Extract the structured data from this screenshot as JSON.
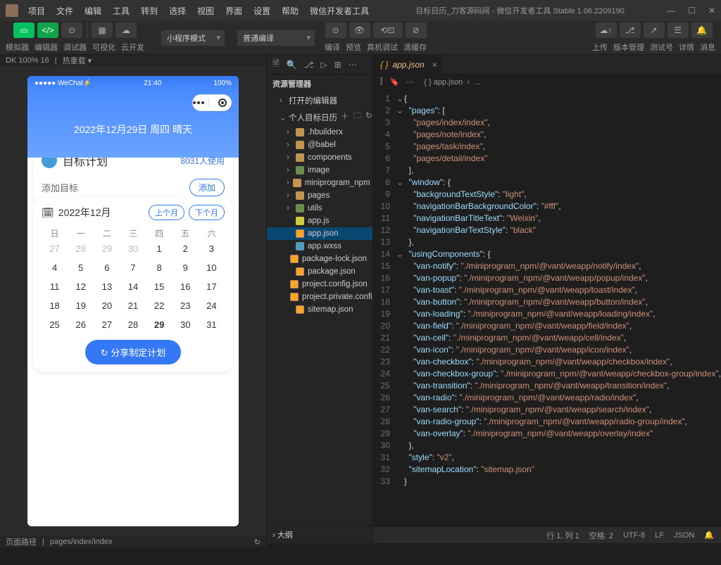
{
  "menus": [
    "项目",
    "文件",
    "编辑",
    "工具",
    "转到",
    "选择",
    "视图",
    "界面",
    "设置",
    "帮助",
    "微信开发者工具"
  ],
  "title": "目标日历_刀客源码网 - 微信开发者工具 Stable 1.06.2209190",
  "toolbar": {
    "left_labels": [
      "模拟器",
      "编辑器",
      "调试器",
      "可视化",
      "云开发"
    ],
    "mode": "小程序模式",
    "compile": "普通编译",
    "mid_labels": [
      "编译",
      "预览",
      "真机调试",
      "清缓存"
    ],
    "right_labels": [
      "上传",
      "版本管理",
      "测试号",
      "详情",
      "消息"
    ]
  },
  "zoom": {
    "dk": "DK 100% 16",
    "hot": "热重载 ▾"
  },
  "phone": {
    "carrier": "●●●●● WeChat⚡",
    "time": "21:40",
    "battery": "100%",
    "heroDate": "2022年12月29日 周四 晴天",
    "planTitle": "目标计划",
    "usersText": "8031人使用",
    "addLabel": "添加目标",
    "addBtn": "添加",
    "monthLabel": "2022年12月",
    "prevMonth": "上个月",
    "nextMonth": "下个月",
    "weekdays": [
      "日",
      "一",
      "二",
      "三",
      "四",
      "五",
      "六"
    ],
    "days": [
      {
        "n": "27"
      },
      {
        "n": "28"
      },
      {
        "n": "29"
      },
      {
        "n": "30"
      },
      {
        "n": "1",
        "c": 1
      },
      {
        "n": "2",
        "c": 1
      },
      {
        "n": "3",
        "c": 1
      },
      {
        "n": "4",
        "c": 1
      },
      {
        "n": "5",
        "c": 1
      },
      {
        "n": "6",
        "c": 1
      },
      {
        "n": "7",
        "c": 1
      },
      {
        "n": "8",
        "c": 1
      },
      {
        "n": "9",
        "c": 1
      },
      {
        "n": "10",
        "c": 1
      },
      {
        "n": "11",
        "c": 1
      },
      {
        "n": "12",
        "c": 1
      },
      {
        "n": "13",
        "c": 1
      },
      {
        "n": "14",
        "c": 1
      },
      {
        "n": "15",
        "c": 1
      },
      {
        "n": "16",
        "c": 1
      },
      {
        "n": "17",
        "c": 1
      },
      {
        "n": "18",
        "c": 1
      },
      {
        "n": "19",
        "c": 1
      },
      {
        "n": "20",
        "c": 1
      },
      {
        "n": "21",
        "c": 1
      },
      {
        "n": "22",
        "c": 1
      },
      {
        "n": "23",
        "c": 1
      },
      {
        "n": "24",
        "c": 1
      },
      {
        "n": "25",
        "c": 1
      },
      {
        "n": "26",
        "c": 1
      },
      {
        "n": "27",
        "c": 1
      },
      {
        "n": "28",
        "c": 1
      },
      {
        "n": "29",
        "t": 1
      },
      {
        "n": "30",
        "c": 1
      },
      {
        "n": "31",
        "c": 1
      }
    ],
    "shareBtn": "↻ 分享制定计划"
  },
  "explorer": {
    "title": "资源管理器",
    "openEditors": "打开的编辑器",
    "project": "个人目标日历",
    "outline": "大纲",
    "items": [
      {
        "label": ".hbuilderx",
        "caret": "›",
        "icon": "folder"
      },
      {
        "label": "@babel",
        "caret": "›",
        "icon": "folder"
      },
      {
        "label": "components",
        "caret": "›",
        "icon": "folder"
      },
      {
        "label": "image",
        "caret": "›",
        "icon": "cfg"
      },
      {
        "label": "miniprogram_npm",
        "caret": "›",
        "icon": "folder"
      },
      {
        "label": "pages",
        "caret": "›",
        "icon": "folder"
      },
      {
        "label": "utils",
        "caret": "›",
        "icon": "cfg"
      },
      {
        "label": "app.js",
        "icon": "js"
      },
      {
        "label": "app.json",
        "icon": "json",
        "sel": true
      },
      {
        "label": "app.wxss",
        "icon": "css"
      },
      {
        "label": "package-lock.json",
        "icon": "json"
      },
      {
        "label": "package.json",
        "icon": "json"
      },
      {
        "label": "project.config.json",
        "icon": "json"
      },
      {
        "label": "project.private.config.js...",
        "icon": "json"
      },
      {
        "label": "sitemap.json",
        "icon": "json"
      }
    ]
  },
  "tabs": {
    "active": "app.json"
  },
  "breadcrumb": [
    "{ } app.json",
    "›",
    "..."
  ],
  "code": {
    "lines": [
      [
        [
          "p",
          "{"
        ]
      ],
      [
        [
          "p",
          "  "
        ],
        [
          "k",
          "\"pages\""
        ],
        [
          "p",
          ": ["
        ]
      ],
      [
        [
          "p",
          "    "
        ],
        [
          "s",
          "\"pages/index/index\""
        ],
        [
          "p",
          ","
        ]
      ],
      [
        [
          "p",
          "    "
        ],
        [
          "s",
          "\"pages/note/index\""
        ],
        [
          "p",
          ","
        ]
      ],
      [
        [
          "p",
          "    "
        ],
        [
          "s",
          "\"pages/task/index\""
        ],
        [
          "p",
          ","
        ]
      ],
      [
        [
          "p",
          "    "
        ],
        [
          "s",
          "\"pages/detail/index\""
        ]
      ],
      [
        [
          "p",
          "  ],"
        ]
      ],
      [
        [
          "p",
          "  "
        ],
        [
          "k",
          "\"window\""
        ],
        [
          "p",
          ": {"
        ]
      ],
      [
        [
          "p",
          "    "
        ],
        [
          "k",
          "\"backgroundTextStyle\""
        ],
        [
          "p",
          ": "
        ],
        [
          "s",
          "\"light\""
        ],
        [
          "p",
          ","
        ]
      ],
      [
        [
          "p",
          "    "
        ],
        [
          "k",
          "\"navigationBarBackgroundColor\""
        ],
        [
          "p",
          ": "
        ],
        [
          "s",
          "\"#fff\""
        ],
        [
          "p",
          ","
        ]
      ],
      [
        [
          "p",
          "    "
        ],
        [
          "k",
          "\"navigationBarTitleText\""
        ],
        [
          "p",
          ": "
        ],
        [
          "s",
          "\"Weixin\""
        ],
        [
          "p",
          ","
        ]
      ],
      [
        [
          "p",
          "    "
        ],
        [
          "k",
          "\"navigationBarTextStyle\""
        ],
        [
          "p",
          ": "
        ],
        [
          "s",
          "\"black\""
        ]
      ],
      [
        [
          "p",
          "  },"
        ]
      ],
      [
        [
          "p",
          "  "
        ],
        [
          "k",
          "\"usingComponents\""
        ],
        [
          "p",
          ": {"
        ]
      ],
      [
        [
          "p",
          "    "
        ],
        [
          "k",
          "\"van-notify\""
        ],
        [
          "p",
          ": "
        ],
        [
          "s",
          "\"./miniprogram_npm/@vant/weapp/notify/index\""
        ],
        [
          "p",
          ","
        ]
      ],
      [
        [
          "p",
          "    "
        ],
        [
          "k",
          "\"van-popup\""
        ],
        [
          "p",
          ": "
        ],
        [
          "s",
          "\"./miniprogram_npm/@vant/weapp/popup/index\""
        ],
        [
          "p",
          ","
        ]
      ],
      [
        [
          "p",
          "    "
        ],
        [
          "k",
          "\"van-toast\""
        ],
        [
          "p",
          ": "
        ],
        [
          "s",
          "\"./miniprogram_npm/@vant/weapp/toast/index\""
        ],
        [
          "p",
          ","
        ]
      ],
      [
        [
          "p",
          "    "
        ],
        [
          "k",
          "\"van-button\""
        ],
        [
          "p",
          ": "
        ],
        [
          "s",
          "\"./miniprogram_npm/@vant/weapp/button/index\""
        ],
        [
          "p",
          ","
        ]
      ],
      [
        [
          "p",
          "    "
        ],
        [
          "k",
          "\"van-loading\""
        ],
        [
          "p",
          ": "
        ],
        [
          "s",
          "\"./miniprogram_npm/@vant/weapp/loading/index\""
        ],
        [
          "p",
          ","
        ]
      ],
      [
        [
          "p",
          "    "
        ],
        [
          "k",
          "\"van-field\""
        ],
        [
          "p",
          ": "
        ],
        [
          "s",
          "\"./miniprogram_npm/@vant/weapp/field/index\""
        ],
        [
          "p",
          ","
        ]
      ],
      [
        [
          "p",
          "    "
        ],
        [
          "k",
          "\"van-cell\""
        ],
        [
          "p",
          ": "
        ],
        [
          "s",
          "\"./miniprogram_npm/@vant/weapp/cell/index\""
        ],
        [
          "p",
          ","
        ]
      ],
      [
        [
          "p",
          "    "
        ],
        [
          "k",
          "\"van-icon\""
        ],
        [
          "p",
          ": "
        ],
        [
          "s",
          "\"./miniprogram_npm/@vant/weapp/icon/index\""
        ],
        [
          "p",
          ","
        ]
      ],
      [
        [
          "p",
          "    "
        ],
        [
          "k",
          "\"van-checkbox\""
        ],
        [
          "p",
          ": "
        ],
        [
          "s",
          "\"./miniprogram_npm/@vant/weapp/checkbox/index\""
        ],
        [
          "p",
          ","
        ]
      ],
      [
        [
          "p",
          "    "
        ],
        [
          "k",
          "\"van-checkbox-group\""
        ],
        [
          "p",
          ": "
        ],
        [
          "s",
          "\"./miniprogram_npm/@vant/weapp/checkbox-group/index\""
        ],
        [
          "p",
          ","
        ]
      ],
      [
        [
          "p",
          "    "
        ],
        [
          "k",
          "\"van-transition\""
        ],
        [
          "p",
          ": "
        ],
        [
          "s",
          "\"./miniprogram_npm/@vant/weapp/transition/index\""
        ],
        [
          "p",
          ","
        ]
      ],
      [
        [
          "p",
          "    "
        ],
        [
          "k",
          "\"van-radio\""
        ],
        [
          "p",
          ": "
        ],
        [
          "s",
          "\"./miniprogram_npm/@vant/weapp/radio/index\""
        ],
        [
          "p",
          ","
        ]
      ],
      [
        [
          "p",
          "    "
        ],
        [
          "k",
          "\"van-search\""
        ],
        [
          "p",
          ": "
        ],
        [
          "s",
          "\"./miniprogram_npm/@vant/weapp/search/index\""
        ],
        [
          "p",
          ","
        ]
      ],
      [
        [
          "p",
          "    "
        ],
        [
          "k",
          "\"van-radio-group\""
        ],
        [
          "p",
          ": "
        ],
        [
          "s",
          "\"./miniprogram_npm/@vant/weapp/radio-group/index\""
        ],
        [
          "p",
          ","
        ]
      ],
      [
        [
          "p",
          "    "
        ],
        [
          "k",
          "\"van-overlay\""
        ],
        [
          "p",
          ": "
        ],
        [
          "s",
          "\"./miniprogram_npm/@vant/weapp/overlay/index\""
        ]
      ],
      [
        [
          "p",
          "  },"
        ]
      ],
      [
        [
          "p",
          "  "
        ],
        [
          "k",
          "\"style\""
        ],
        [
          "p",
          ": "
        ],
        [
          "s",
          "\"v2\""
        ],
        [
          "p",
          ","
        ]
      ],
      [
        [
          "p",
          "  "
        ],
        [
          "k",
          "\"sitemapLocation\""
        ],
        [
          "p",
          ": "
        ],
        [
          "s",
          "\"sitemap.json\""
        ]
      ],
      [
        [
          "p",
          "}"
        ]
      ]
    ],
    "folds": {
      "0": "⌄",
      "1": "⌄",
      "7": "⌄",
      "13": "⌄"
    }
  },
  "status": {
    "path": "pages/index/index",
    "pos": "行 1, 列 1",
    "spaces": "空格: 2",
    "enc": "UTF-8",
    "eol": "LF",
    "lang": "JSON"
  },
  "footer": {
    "label": "页面路径"
  }
}
